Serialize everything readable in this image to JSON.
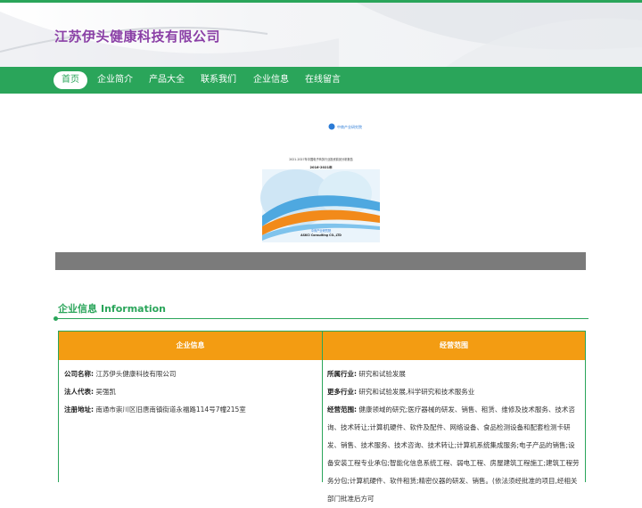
{
  "site": {
    "title": "江苏伊头健康科技有限公司"
  },
  "nav": {
    "items": [
      {
        "label": "首页",
        "active": true
      },
      {
        "label": "企业简介"
      },
      {
        "label": "产品大全"
      },
      {
        "label": "联系我们"
      },
      {
        "label": "企业信息"
      },
      {
        "label": "在线留言"
      }
    ]
  },
  "banner": {
    "brand": "中商产业研究院",
    "report_title": "2021-2027年中国电子商务行业投资前景分析报告",
    "years": "2016-2021年",
    "footer_cn": "中商产业研究院",
    "footer_en": "ASKCI Consulting CO.,LTD"
  },
  "section": {
    "title_cn": "企业信息",
    "title_en": "Information"
  },
  "table": {
    "headers": {
      "left": "企业信息",
      "right": "经营范围"
    },
    "left_rows": [
      {
        "label": "公司名称:",
        "value": "江苏伊头健康科技有限公司"
      },
      {
        "label": "法人代表:",
        "value": "吴强凯"
      },
      {
        "label": "注册地址:",
        "value": "南通市崇川区旧唐南镇街道永福路114号7幢215室"
      }
    ],
    "right_rows": [
      {
        "label": "所属行业:",
        "value": "研究和试验发展"
      },
      {
        "label": "更多行业:",
        "value": "研究和试验发展,科学研究和技术服务业"
      },
      {
        "label": "经营范围:",
        "value": "健康领域的研究;医疗器械的研发、销售、租赁、维修及技术服务、技术咨询、技术转让;计算机硬件、软件及配件、网络设备、食品检测设备和配套检测卡研发、销售、技术服务、技术咨询、技术转让;计算机系统集成服务;电子产品的销售;设备安装工程专业承包;智能化信息系统工程、弱电工程、房屋建筑工程施工;建筑工程劳务分包;计算机硬件、软件租赁;精密仪器的研发、销售。(依法须经批准的项目,经相关部门批准后方可"
      }
    ]
  },
  "colors": {
    "green": "#2aa55a",
    "orange": "#f39c12",
    "purple": "#8a3fa6",
    "grey": "#7b7b7b"
  }
}
